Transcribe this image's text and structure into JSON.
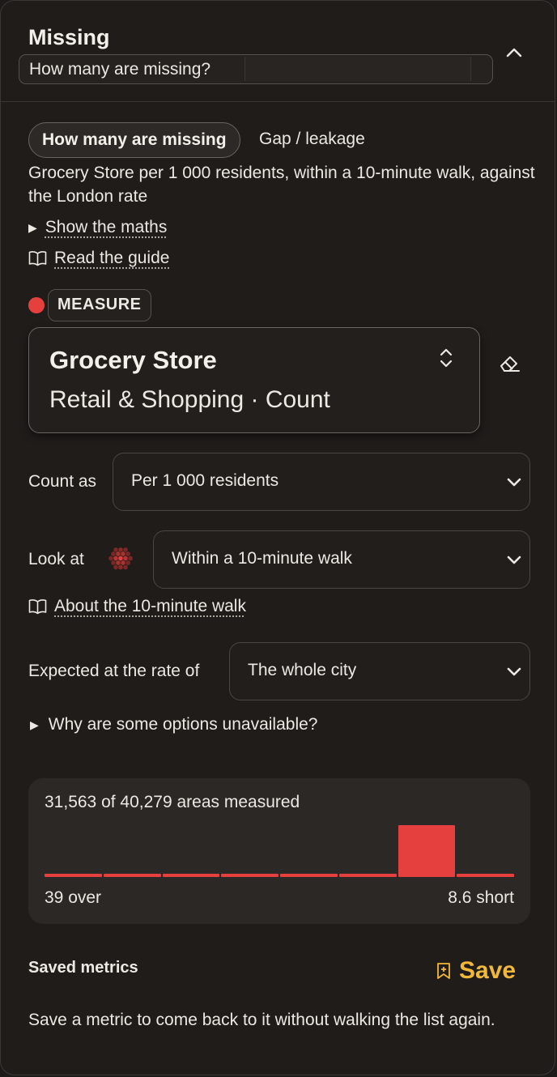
{
  "header": {
    "title": "Missing",
    "question_value": "How many are missing?"
  },
  "intro": {
    "mode_pill": "How many are missing",
    "mode_alt": "Gap / leakage",
    "description": "Grocery Store per 1 000 residents, within a 10-minute walk, against the London rate",
    "show_maths": "Show the maths",
    "read_guide": "Read the guide"
  },
  "measure": {
    "badge": "MEASURE",
    "dot_color": "#e5403d",
    "name": "Grocery Store",
    "subtitle": "Retail & Shopping · Count"
  },
  "controls": {
    "count_as_label": "Count as",
    "count_as_value": "Per 1 000 residents",
    "look_at_label": "Look at",
    "look_at_value": "Within a 10-minute walk",
    "about_walk": "About the 10-minute walk",
    "expected_label": "Expected at the rate of",
    "expected_value": "The whole city",
    "unavailable": "Why are some options unavailable?"
  },
  "histogram": {
    "title": "31,563 of 40,279 areas measured",
    "left_label": "39 over",
    "right_label": "8.6 short",
    "bins": [
      0.06,
      0.06,
      0.06,
      0.06,
      0.06,
      0.06,
      1.0,
      0.06
    ],
    "color": "#e5403d"
  },
  "saved": {
    "label": "Saved metrics",
    "button": "Save",
    "accent": "#f2b83a",
    "description": "Save a metric to come back to it without walking the list again."
  }
}
